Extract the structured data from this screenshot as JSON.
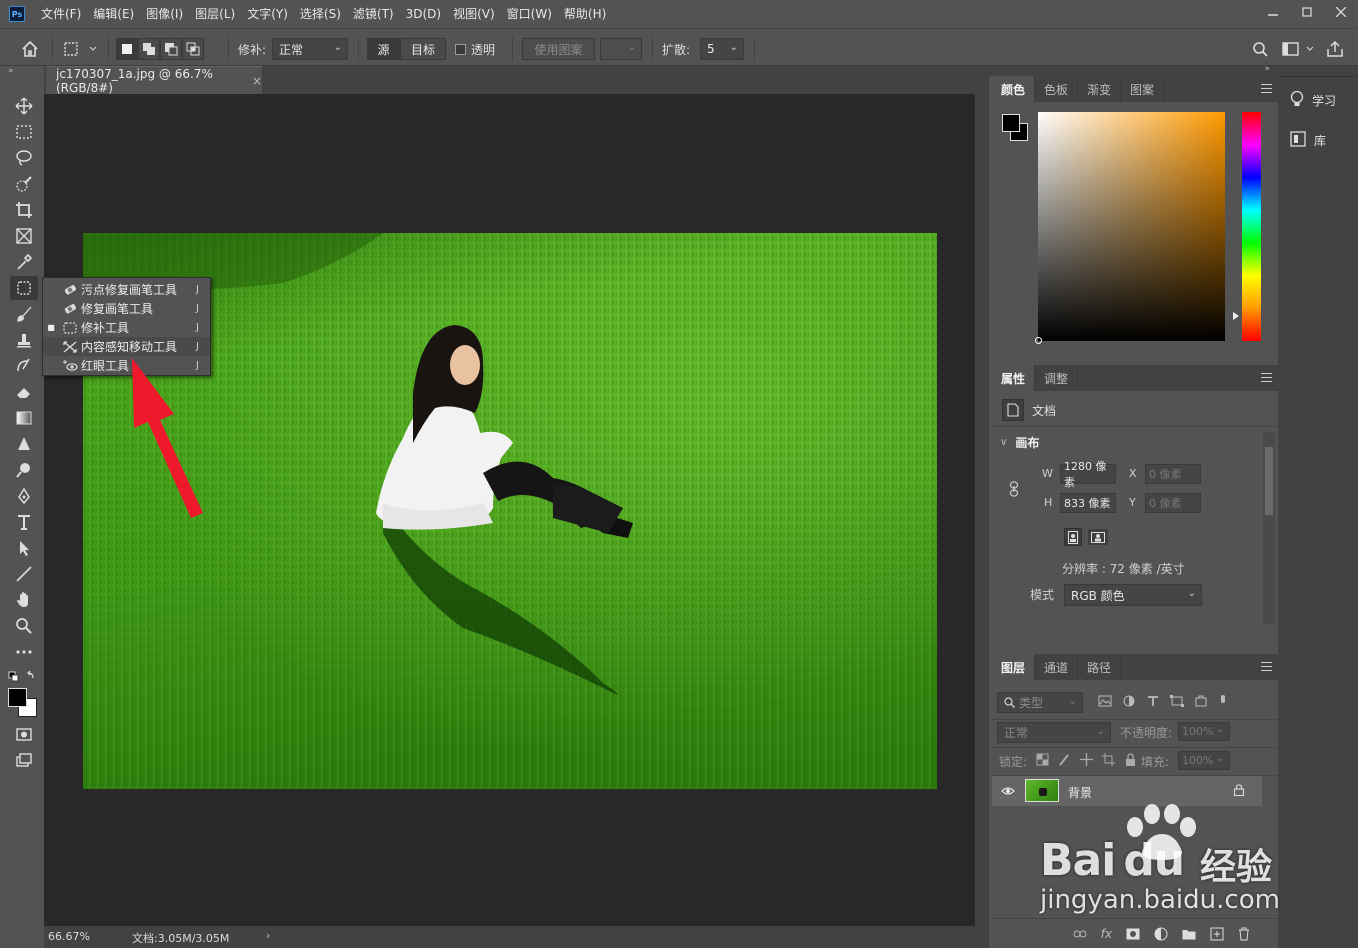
{
  "app": {
    "logo": "Ps",
    "menu": [
      "文件(F)",
      "编辑(E)",
      "图像(I)",
      "图层(L)",
      "文字(Y)",
      "选择(S)",
      "滤镜(T)",
      "3D(D)",
      "视图(V)",
      "窗口(W)",
      "帮助(H)"
    ],
    "window_controls": [
      "minimize-icon",
      "restore-icon",
      "close-icon"
    ]
  },
  "options_bar": {
    "patch_label": "修补:",
    "patch_value": "正常",
    "source_label": "源",
    "target_label": "目标",
    "transparent_label": "透明",
    "use_pattern_label": "使用图案",
    "diffuse_label": "扩散:",
    "diffuse_value": "5"
  },
  "document": {
    "tab_title": "jc170307_1a.jpg @ 66.7%(RGB/8#)",
    "zoom": "66.67%",
    "doc_info": "文档:3.05M/3.05M"
  },
  "tool_flyout": {
    "items": [
      {
        "label": "污点修复画笔工具",
        "key": "J",
        "icon": "spot-healing-brush-icon",
        "selected": false
      },
      {
        "label": "修复画笔工具",
        "key": "J",
        "icon": "healing-brush-icon",
        "selected": false
      },
      {
        "label": "修补工具",
        "key": "J",
        "icon": "patch-tool-icon",
        "selected": true
      },
      {
        "label": "内容感知移动工具",
        "key": "J",
        "icon": "content-aware-move-icon",
        "selected": false
      },
      {
        "label": "红眼工具",
        "key": "J",
        "icon": "red-eye-icon",
        "selected": false
      }
    ]
  },
  "color_panel": {
    "tabs": [
      "颜色",
      "色板",
      "渐变",
      "图案"
    ],
    "foreground": "#000000",
    "background": "#ffffff",
    "hue_color": "#ff9900"
  },
  "properties_panel": {
    "tabs": [
      "属性",
      "调整"
    ],
    "doc_label": "文档",
    "section": "画布",
    "w_label": "W",
    "w_value": "1280 像素",
    "h_label": "H",
    "h_value": "833 像素",
    "x_label": "X",
    "x_value": "0 像素",
    "y_label": "Y",
    "y_value": "0 像素",
    "resolution": "分辨率 : 72 像素 /英寸",
    "mode_label": "模式",
    "mode_value": "RGB 颜色"
  },
  "layers_panel": {
    "tabs": [
      "图层",
      "通道",
      "路径"
    ],
    "filter_placeholder": "类型",
    "blend_mode": "正常",
    "opacity_label": "不透明度:",
    "opacity_value": "100%",
    "lock_label": "锁定:",
    "fill_label": "填充:",
    "fill_value": "100%",
    "layers": [
      {
        "name": "背景",
        "visible": true,
        "locked": true
      }
    ]
  },
  "far_right_panel": {
    "learn_label": "学习",
    "library_label": "库"
  },
  "watermark": {
    "brand": "Bai",
    "brand2": "du",
    "suffix": "经验",
    "url": "jingyan.baidu.com"
  }
}
